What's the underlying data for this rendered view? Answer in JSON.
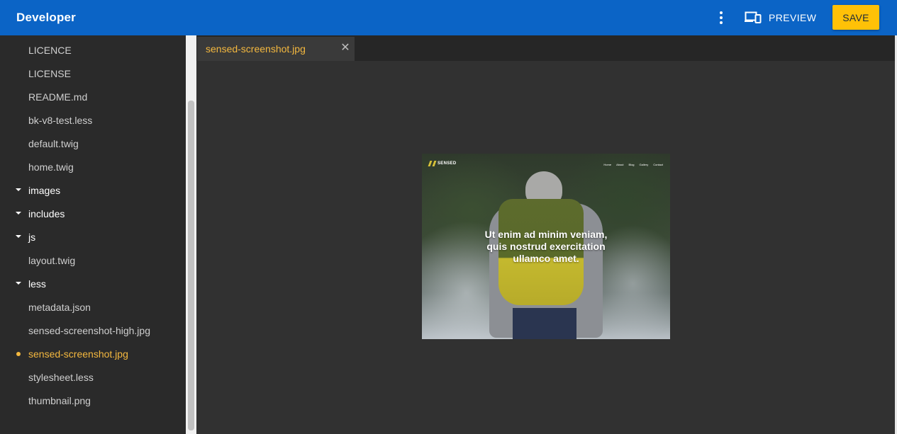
{
  "app": {
    "title": "Developer"
  },
  "toolbar": {
    "preview_label": "PREVIEW",
    "save_label": "SAVE"
  },
  "sidebar": {
    "items": [
      {
        "label": "LICENCE",
        "type": "file"
      },
      {
        "label": "LICENSE",
        "type": "file"
      },
      {
        "label": "README.md",
        "type": "file"
      },
      {
        "label": "bk-v8-test.less",
        "type": "file"
      },
      {
        "label": "default.twig",
        "type": "file"
      },
      {
        "label": "home.twig",
        "type": "file"
      },
      {
        "label": "images",
        "type": "folder"
      },
      {
        "label": "includes",
        "type": "folder"
      },
      {
        "label": "js",
        "type": "folder"
      },
      {
        "label": "layout.twig",
        "type": "file"
      },
      {
        "label": "less",
        "type": "folder"
      },
      {
        "label": "metadata.json",
        "type": "file"
      },
      {
        "label": "sensed-screenshot-high.jpg",
        "type": "file"
      },
      {
        "label": "sensed-screenshot.jpg",
        "type": "file",
        "active": true
      },
      {
        "label": "stylesheet.less",
        "type": "file"
      },
      {
        "label": "thumbnail.png",
        "type": "file"
      }
    ]
  },
  "editor": {
    "tabs": [
      {
        "label": "sensed-screenshot.jpg",
        "active": true
      }
    ]
  },
  "image_preview": {
    "logo": "SENSED",
    "nav": [
      "Home",
      "About",
      "Blog",
      "Gallery",
      "Contact"
    ],
    "headline": [
      "Ut enim ad minim veniam,",
      "quis nostrud exercitation",
      "ullamco amet."
    ]
  },
  "colors": {
    "topbar": "#0b64c6",
    "save": "#ffc107",
    "active_file": "#f4b83f",
    "sidebar": "#2a2a2a",
    "editor": "#313131"
  }
}
